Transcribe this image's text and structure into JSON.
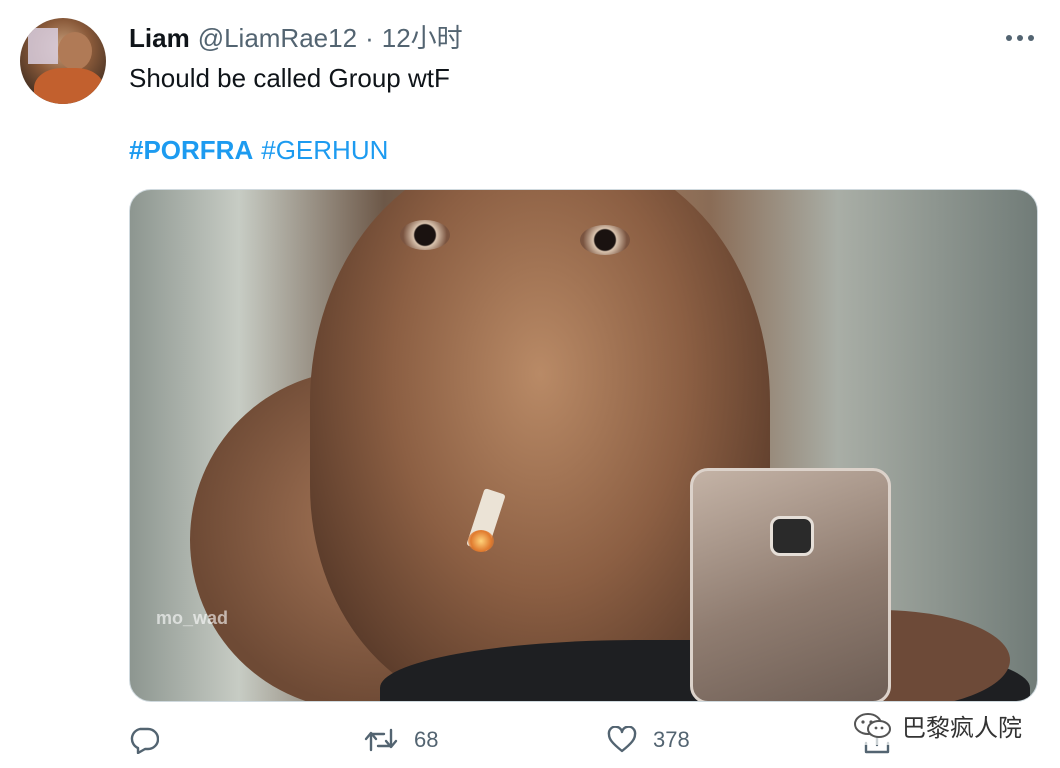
{
  "tweet": {
    "author_name": "Liam",
    "author_handle": "@LiamRae12",
    "separator": "·",
    "timestamp": "12小时",
    "text": "Should be called Group wtF",
    "hashtags": [
      "#PORFRA",
      "#GERHUN"
    ],
    "media_watermark": "mo_wad"
  },
  "actions": {
    "reply_count": "",
    "retweet_count": "68",
    "like_count": "378"
  },
  "overlay": {
    "wechat_watermark": "巴黎疯人院"
  },
  "colors": {
    "link": "#1d9bf0",
    "secondary_text": "#536471",
    "primary_text": "#0f1419"
  },
  "icons": [
    "more-icon",
    "reply-icon",
    "retweet-icon",
    "like-icon",
    "share-icon",
    "wechat-icon"
  ]
}
